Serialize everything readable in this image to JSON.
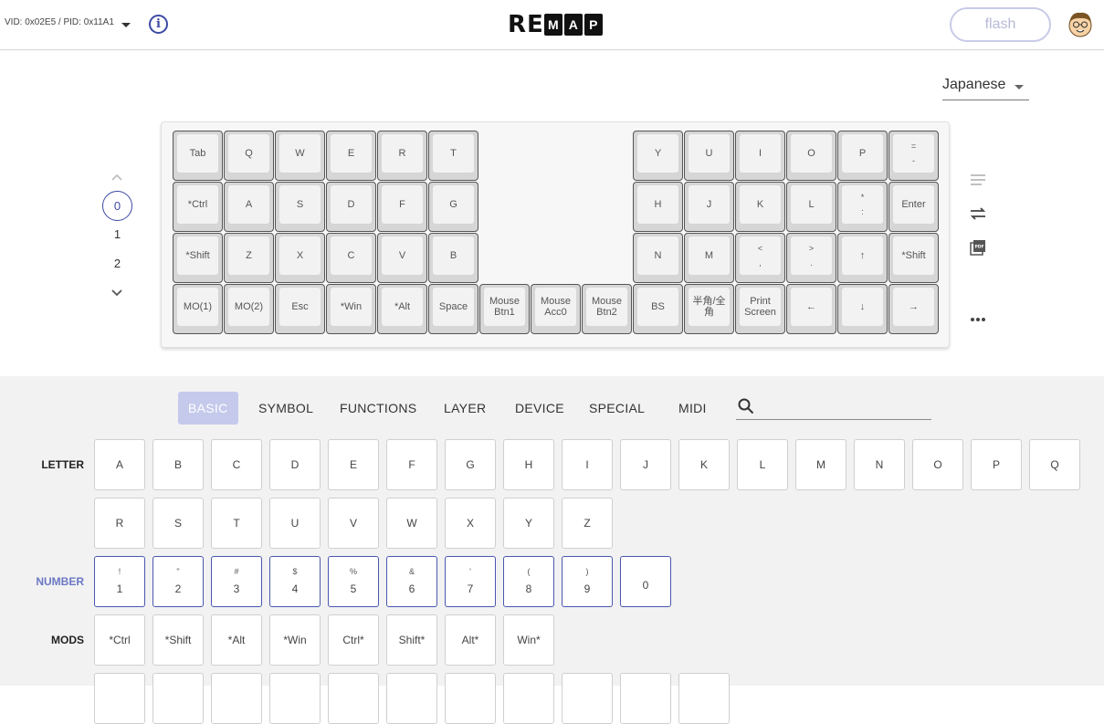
{
  "header": {
    "vid_pid": "VID: 0x02E5 / PID: 0x11A1",
    "logo_parts": [
      "R",
      "E",
      "M",
      "A",
      "P"
    ],
    "flash_label": "flash"
  },
  "language": {
    "selected": "Japanese"
  },
  "layers": {
    "items": [
      "0",
      "1",
      "2"
    ],
    "selected": "0"
  },
  "keyboard": {
    "rows": [
      [
        "Tab",
        "Q",
        "W",
        "E",
        "R",
        "T"
      ],
      [
        "*Ctrl",
        "A",
        "S",
        "D",
        "F",
        "G"
      ],
      [
        "*Shift",
        "Z",
        "X",
        "C",
        "V",
        "B"
      ],
      [
        "MO(1)",
        "MO(2)",
        "Esc",
        "*Win",
        "*Alt",
        "Space",
        "Mouse Btn1",
        "Mouse Acc0",
        "Mouse Btn2"
      ]
    ],
    "right_rows": [
      [
        "Y",
        "U",
        "I",
        "O",
        "P",
        "=|-"
      ],
      [
        "H",
        "J",
        "K",
        "L",
        "*|:",
        "Enter"
      ],
      [
        "N",
        "M",
        "<|,",
        ">|.",
        "↑",
        "*Shift"
      ],
      [
        "BS",
        "半角/全角",
        "Print Screen",
        "←",
        "↓",
        "→"
      ]
    ]
  },
  "palette": {
    "tabs": [
      "BASIC",
      "SYMBOL",
      "FUNCTIONS",
      "LAYER",
      "DEVICE",
      "SPECIAL",
      "MIDI"
    ],
    "active_tab": "BASIC",
    "search_placeholder": "",
    "rows": {
      "letter_label": "LETTER",
      "letters": [
        "A",
        "B",
        "C",
        "D",
        "E",
        "F",
        "G",
        "H",
        "I",
        "J",
        "K",
        "L",
        "M",
        "N",
        "O",
        "P",
        "Q",
        "R",
        "S",
        "T",
        "U",
        "V",
        "W",
        "X",
        "Y",
        "Z"
      ],
      "number_label": "NUMBER",
      "numbers": [
        {
          "sub": "!",
          "main": "1"
        },
        {
          "sub": "\"",
          "main": "2"
        },
        {
          "sub": "#",
          "main": "3"
        },
        {
          "sub": "$",
          "main": "4"
        },
        {
          "sub": "%",
          "main": "5"
        },
        {
          "sub": "&",
          "main": "6"
        },
        {
          "sub": "'",
          "main": "7"
        },
        {
          "sub": "(",
          "main": "8"
        },
        {
          "sub": ")",
          "main": "9"
        },
        {
          "sub": "",
          "main": "0"
        }
      ],
      "mods_label": "MODS",
      "mods": [
        "*Ctrl",
        "*Shift",
        "*Alt",
        "*Win",
        "Ctrl*",
        "Shift*",
        "Alt*",
        "Win*"
      ]
    }
  },
  "colors": {
    "accent": "#3d4aa4",
    "tab_active_bg": "#c5caec",
    "palette_bg": "#f2f2f2"
  }
}
